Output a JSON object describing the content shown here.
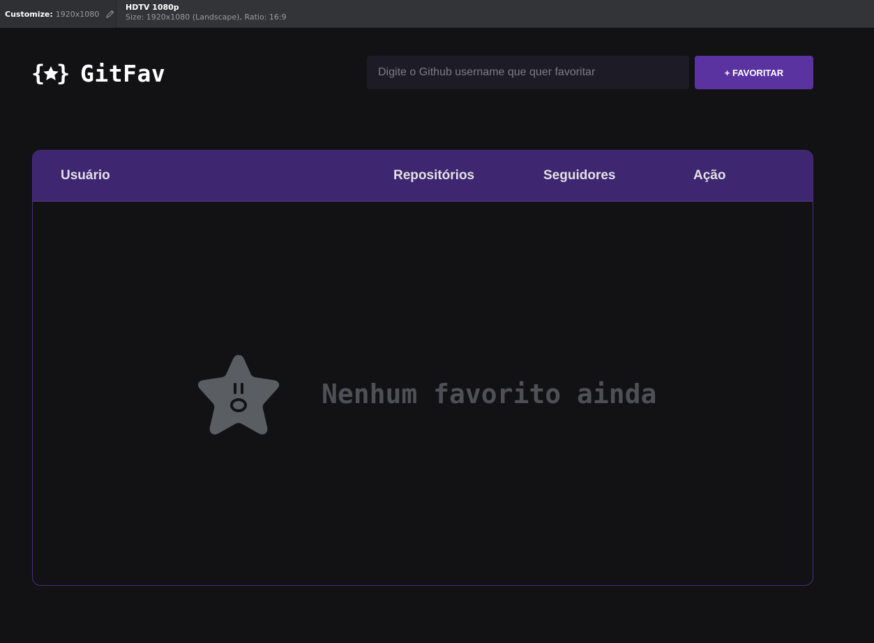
{
  "devbar": {
    "customize_label": "Customize:",
    "customize_value": "1920x1080",
    "preset_name": "HDTV 1080p",
    "preset_meta": "Size: 1920x1080 (Landscape), Ratio: 16:9",
    "edit_icon": "pencil-icon"
  },
  "header": {
    "logo_icon": "braces-star-icon",
    "brand": "GitFav",
    "search_placeholder": "Digite o Github username que quer favoritar",
    "search_value": "",
    "favorite_button": "+ FAVORITAR"
  },
  "table": {
    "columns": [
      "Usuário",
      "Repositórios",
      "Seguidores",
      "Ação"
    ],
    "rows": [],
    "empty_icon": "surprised-star-icon",
    "empty_message": "Nenhum favorito ainda"
  },
  "colors": {
    "background": "#121214",
    "accent": "#5a33a0",
    "table_header": "#3f2670",
    "input_bg": "#1d1b26",
    "muted_text": "#4e5055"
  }
}
